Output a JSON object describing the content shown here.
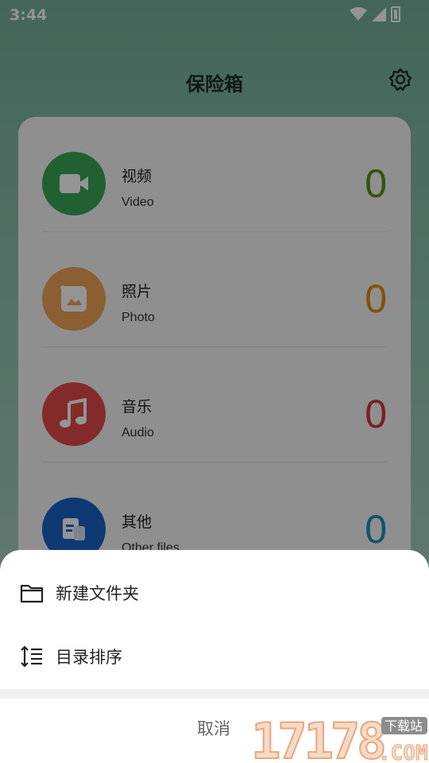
{
  "status_bar": {
    "time": "3:44"
  },
  "header": {
    "title": "保险箱",
    "settings_icon": "gear-icon"
  },
  "vault": {
    "items": [
      {
        "name": "视频",
        "sub": "Video",
        "count": "0",
        "color": "#3aa655",
        "count_color": "#5f8f12",
        "icon": "video-camera-icon"
      },
      {
        "name": "照片",
        "sub": "Photo",
        "count": "0",
        "color": "#f0a455",
        "count_color": "#e48a12",
        "icon": "photo-icon"
      },
      {
        "name": "音乐",
        "sub": "Audio",
        "count": "0",
        "color": "#e24a4a",
        "count_color": "#d13a3a",
        "icon": "music-note-icon"
      },
      {
        "name": "其他",
        "sub": "Other files",
        "count": "0",
        "color": "#1a63c4",
        "count_color": "#1e8fb8",
        "icon": "document-icon"
      }
    ]
  },
  "sheet": {
    "items": [
      {
        "label": "新建文件夹",
        "icon": "folder-icon"
      },
      {
        "label": "目录排序",
        "icon": "sort-icon"
      }
    ],
    "cancel_label": "取消"
  },
  "watermark": {
    "text": "17178",
    "suffix": ".COM",
    "badge": "下载站"
  }
}
